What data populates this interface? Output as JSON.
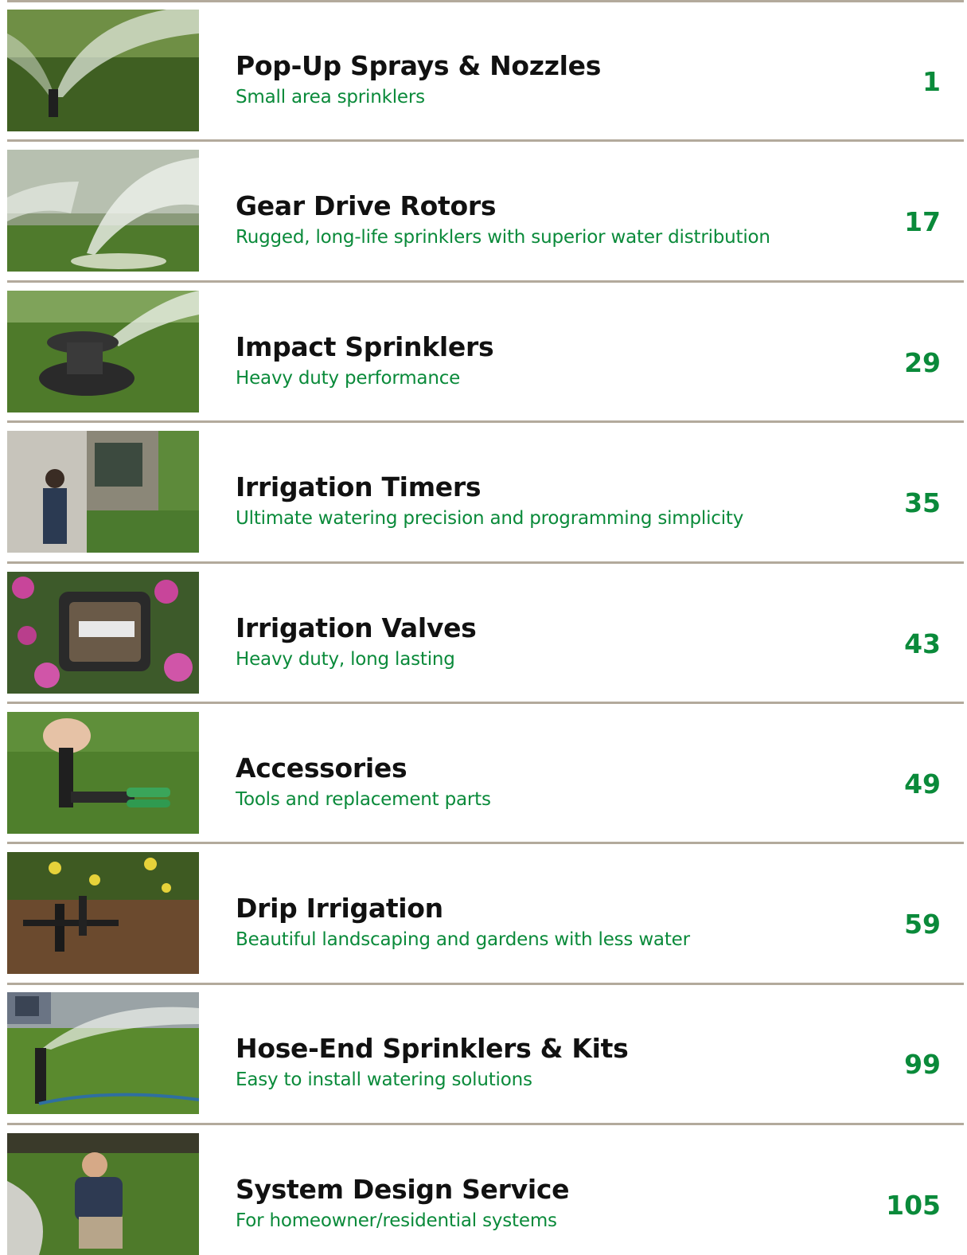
{
  "entries": [
    {
      "title": "Pop-Up Sprays & Nozzles",
      "subtitle": "Small area sprinklers",
      "page": "1",
      "image": "pop-up-spray-photo"
    },
    {
      "title": "Gear Drive Rotors",
      "subtitle": "Rugged, long-life sprinklers with superior water distribution",
      "page": "17",
      "image": "gear-drive-rotor-photo"
    },
    {
      "title": "Impact Sprinklers",
      "subtitle": "Heavy duty performance",
      "page": "29",
      "image": "impact-sprinkler-photo"
    },
    {
      "title": "Irrigation Timers",
      "subtitle": "Ultimate watering precision and programming simplicity",
      "page": "35",
      "image": "irrigation-timer-photo"
    },
    {
      "title": "Irrigation Valves",
      "subtitle": "Heavy duty, long lasting",
      "page": "43",
      "image": "irrigation-valve-photo"
    },
    {
      "title": "Accessories",
      "subtitle": "Tools and replacement parts",
      "page": "49",
      "image": "accessories-photo"
    },
    {
      "title": "Drip Irrigation",
      "subtitle": "Beautiful landscaping and gardens with less water",
      "page": "59",
      "image": "drip-irrigation-photo"
    },
    {
      "title": "Hose-End Sprinklers & Kits",
      "subtitle": "Easy to install watering solutions",
      "page": "99",
      "image": "hose-end-sprinkler-photo"
    },
    {
      "title": "System Design Service",
      "subtitle": "For homeowner/residential systems",
      "page": "105",
      "image": "system-design-photo"
    }
  ],
  "colors": {
    "title": "#111111",
    "subtitle": "#0a8a3a",
    "page_number": "#0a8a3a",
    "divider": "#b3aa9c"
  }
}
